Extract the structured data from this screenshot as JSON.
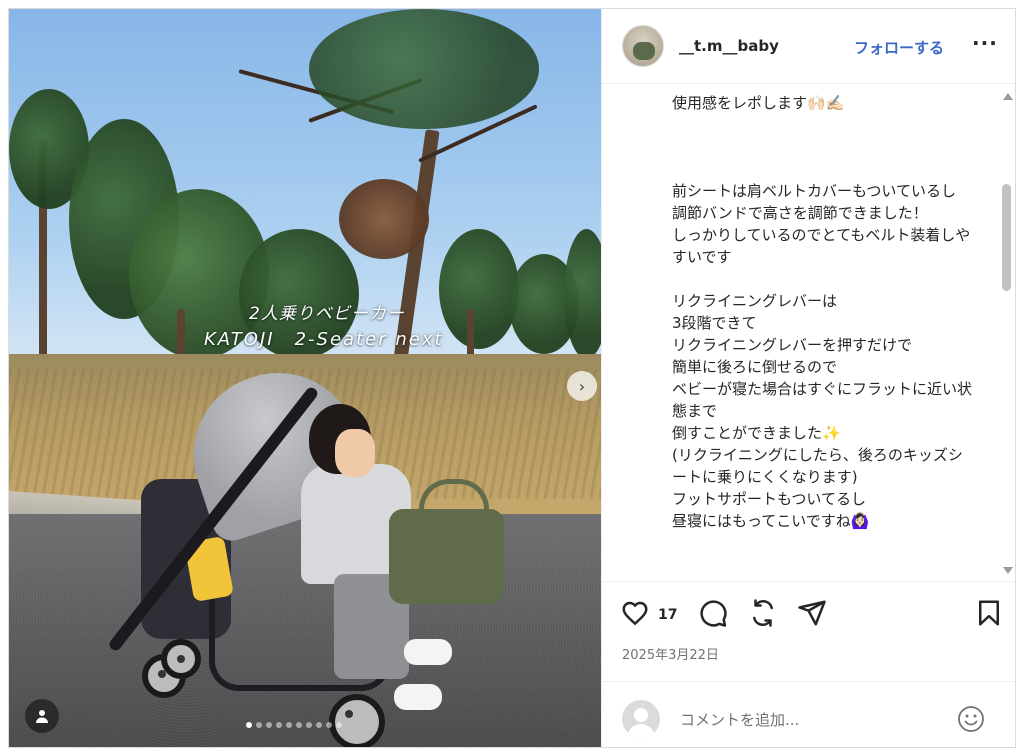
{
  "post": {
    "username": "__t.m__baby",
    "follow_label": "フォローする",
    "more_label": "···",
    "image_overlay": {
      "line1": "2人乗りベビーカー",
      "line2": "KATOJI　2-Seater next"
    },
    "carousel": {
      "total": 10,
      "active": 1
    },
    "next_label": "›",
    "caption": "使用感をレポします🙌🏻✍🏻\n\n\n\n前シートは肩ベルトカバーもついているし\n調節バンドで高さを調節できました！\nしっかりしているのでとてもベルト装着しやすいです\n\nリクライニングレバーは\n3段階できて\nリクライニングレバーを押すだけで\n簡単に後ろに倒せるので\nベビーが寝た場合はすぐにフラットに近い状態まで\n倒すことができました✨\n(リクライニングにしたら、後ろのキッズシートに乗りにくくなります)\nフットサポートもついてるし\n昼寝にはもってこいですね🙆🏻‍♀️",
    "likes": "17",
    "date": "2025年3月22日"
  },
  "comment": {
    "placeholder": "コメントを追加..."
  },
  "icons": {
    "like": "heart-icon",
    "comment": "comment-icon",
    "share": "repost-icon",
    "send": "send-icon",
    "save": "bookmark-icon",
    "emoji": "smiley-icon",
    "tag": "user-tag-icon"
  },
  "colors": {
    "follow": "#3b67c8",
    "text": "#262626",
    "muted": "#737373",
    "border": "#dbdbdb"
  }
}
